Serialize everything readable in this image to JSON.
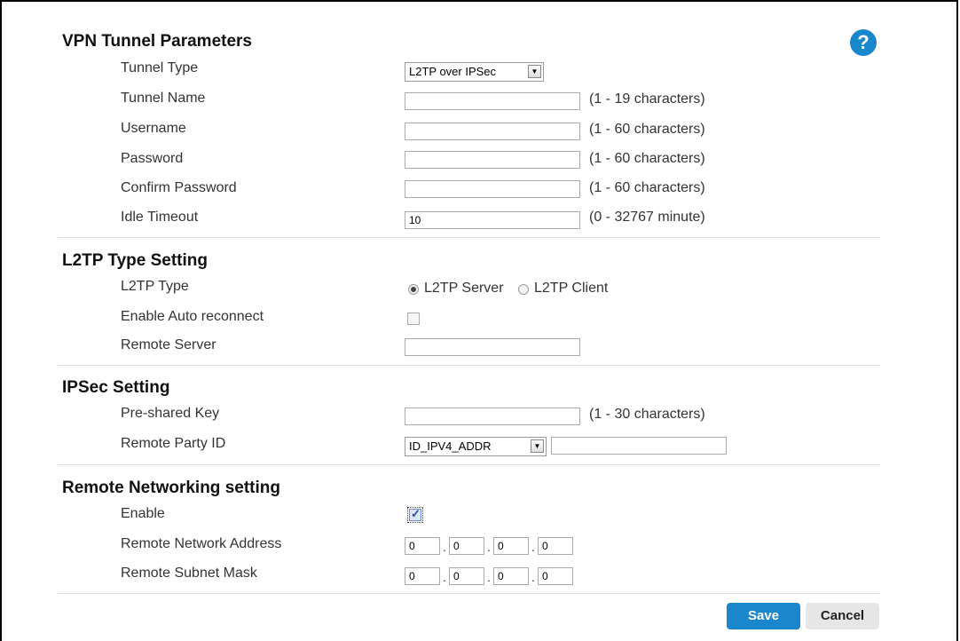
{
  "sections": {
    "vpn": {
      "title": "VPN Tunnel Parameters",
      "tunnel_type": {
        "label": "Tunnel Type",
        "value": "L2TP over IPSec"
      },
      "tunnel_name": {
        "label": "Tunnel Name",
        "value": "",
        "hint": "(1 - 19 characters)"
      },
      "username": {
        "label": "Username",
        "value": "",
        "hint": "(1 - 60 characters)"
      },
      "password": {
        "label": "Password",
        "value": "",
        "hint": "(1 - 60 characters)"
      },
      "confirm_password": {
        "label": "Confirm Password",
        "value": "",
        "hint": "(1 - 60 characters)"
      },
      "idle_timeout": {
        "label": "Idle Timeout",
        "value": "10",
        "hint": "(0 - 32767 minute)"
      }
    },
    "l2tp": {
      "title": "L2TP Type Setting",
      "type": {
        "label": "L2TP Type",
        "server": "L2TP Server",
        "client": "L2TP Client",
        "selected": "server"
      },
      "auto_reconnect": {
        "label": "Enable Auto reconnect",
        "checked": false
      },
      "remote_server": {
        "label": "Remote Server",
        "value": ""
      }
    },
    "ipsec": {
      "title": "IPSec Setting",
      "psk": {
        "label": "Pre-shared Key",
        "value": "",
        "hint": "(1 - 30 characters)"
      },
      "remote_party_id": {
        "label": "Remote Party ID",
        "type": "ID_IPV4_ADDR",
        "value": ""
      }
    },
    "remote_net": {
      "title": "Remote Networking setting",
      "enable": {
        "label": "Enable",
        "checked": true
      },
      "address": {
        "label": "Remote Network Address",
        "octets": [
          "0",
          "0",
          "0",
          "0"
        ]
      },
      "mask": {
        "label": "Remote Subnet Mask",
        "octets": [
          "0",
          "0",
          "0",
          "0"
        ]
      }
    }
  },
  "buttons": {
    "save": "Save",
    "cancel": "Cancel"
  },
  "help": {
    "icon": "question-icon",
    "glyph": "?"
  },
  "colors": {
    "accent": "#1a86cc",
    "cancel_bg": "#e6e6e6"
  }
}
